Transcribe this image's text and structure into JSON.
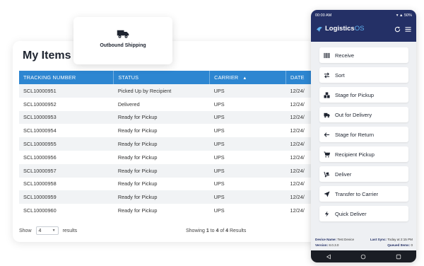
{
  "items_card": {
    "title": "My Items",
    "columns": [
      "TRACKING NUMBER",
      "STATUS",
      "CARRIER",
      "DATE"
    ],
    "rows": [
      {
        "tracking": "SCL10000951",
        "status": "Picked Up by Recipient",
        "carrier": "UPS",
        "date": "12/24/"
      },
      {
        "tracking": "SCL10000952",
        "status": "Delivered",
        "carrier": "UPS",
        "date": "12/24/"
      },
      {
        "tracking": "SCL10000953",
        "status": "Ready for Pickup",
        "carrier": "UPS",
        "date": "12/24/"
      },
      {
        "tracking": "SCL10000954",
        "status": "Ready for Pickup",
        "carrier": "UPS",
        "date": "12/24/"
      },
      {
        "tracking": "SCL10000955",
        "status": "Ready for Pickup",
        "carrier": "UPS",
        "date": "12/24/"
      },
      {
        "tracking": "SCL10000956",
        "status": "Ready for Pickup",
        "carrier": "UPS",
        "date": "12/24/"
      },
      {
        "tracking": "SCL10000957",
        "status": "Ready for Pickup",
        "carrier": "UPS",
        "date": "12/24/"
      },
      {
        "tracking": "SCL10000958",
        "status": "Ready for Pickup",
        "carrier": "UPS",
        "date": "12/24/"
      },
      {
        "tracking": "SCL10000959",
        "status": "Ready for Pickup",
        "carrier": "UPS",
        "date": "12/24/"
      },
      {
        "tracking": "SCL10000960",
        "status": "Ready for Pickup",
        "carrier": "UPS",
        "date": "12/24/"
      }
    ],
    "footer": {
      "show_label": "Show",
      "show_value": "4",
      "results_label": "results",
      "paging_prefix": "Showing",
      "paging_from": "1",
      "paging_to_word": "to",
      "paging_to": "4",
      "paging_of_word": "of",
      "paging_total": "4",
      "paging_suffix": "Results"
    }
  },
  "floating_card": {
    "label": "Outbound Shipping",
    "icon": "truck-icon"
  },
  "phone": {
    "status_time": "00:00 AM",
    "status_battery": "50%",
    "brand_main": "Logistics",
    "brand_suffix": "OS",
    "menu": [
      {
        "label": "Receive",
        "icon": "barcode-icon"
      },
      {
        "label": "Sort",
        "icon": "sort-arrows-icon"
      },
      {
        "label": "Stage for Pickup",
        "icon": "boxes-icon"
      },
      {
        "label": "Out for Delivery",
        "icon": "truck-icon"
      },
      {
        "label": "Stage for Return",
        "icon": "arrow-left-icon"
      },
      {
        "label": "Recipient Pickup",
        "icon": "cart-icon"
      },
      {
        "label": "Deliver",
        "icon": "dolly-icon"
      },
      {
        "label": "Transfer to Carrier",
        "icon": "send-icon"
      },
      {
        "label": "Quick Deliver",
        "icon": "bolt-icon"
      }
    ],
    "footer": {
      "device_label": "Device Name:",
      "device_value": "Test Device",
      "sync_label": "Last Sync:",
      "sync_value": "Today at 2:15 PM",
      "version_label": "Version:",
      "version_value": "8.0.3.0",
      "queued_label": "Queued Items:",
      "queued_value": "0"
    }
  },
  "colors": {
    "table_header": "#2d86d1",
    "phone_header": "#243066",
    "brand_accent": "#5fb3f0"
  }
}
